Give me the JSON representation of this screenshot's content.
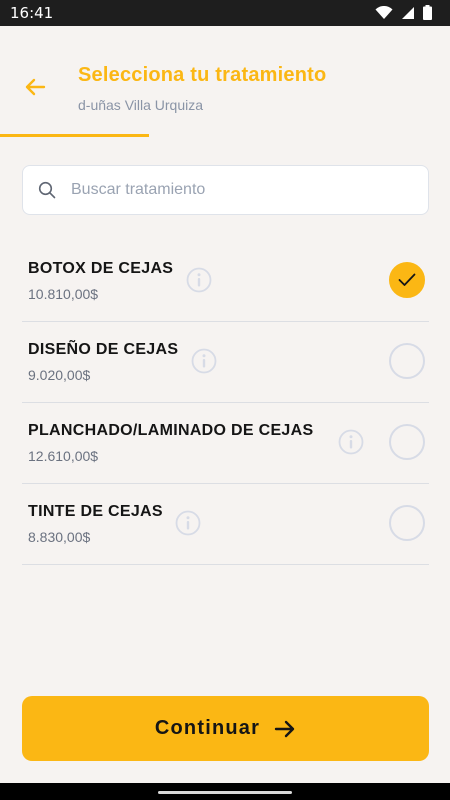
{
  "status_bar": {
    "time": "16:41",
    "icons": [
      "wifi-icon",
      "signal-icon",
      "battery-icon"
    ]
  },
  "header": {
    "title": "Selecciona tu tratamiento",
    "subtitle": "d-uñas Villa Urquiza",
    "step_progress": 0.33
  },
  "search": {
    "placeholder": "Buscar tratamiento",
    "value": ""
  },
  "treatments": [
    {
      "name": "BOTOX DE CEJAS",
      "price": "10.810,00$",
      "selected": true
    },
    {
      "name": "DISEÑO DE CEJAS",
      "price": "9.020,00$",
      "selected": false
    },
    {
      "name": "PLANCHADO/LAMINADO DE CEJAS",
      "price": "12.610,00$",
      "selected": false
    },
    {
      "name": "TINTE DE CEJAS",
      "price": "8.830,00$",
      "selected": false
    }
  ],
  "continue_button": {
    "label": "Continuar"
  },
  "colors": {
    "accent": "#fbb714",
    "background": "#f6f3f1",
    "muted_text": "#8a94a6"
  }
}
